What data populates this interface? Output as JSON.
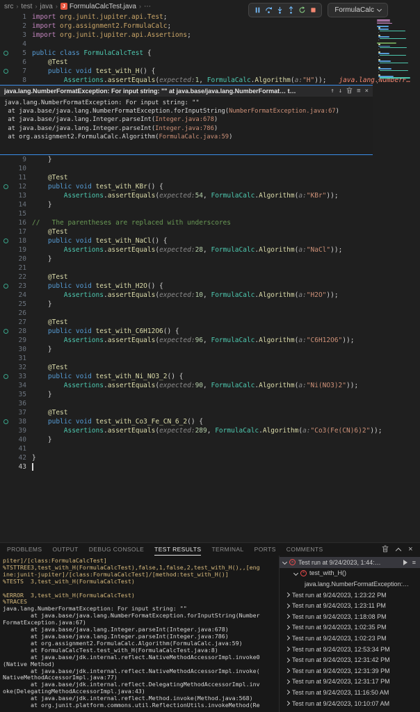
{
  "colors": {
    "accent_blue": "#3b8eea",
    "error_red": "#f14c4c",
    "inline_error_red": "#f48771",
    "test_gutter_teal": "#3aa58b",
    "debug_pause_blue": "#75beff",
    "debug_restart_green": "#89d185",
    "debug_stop_red": "#f48771",
    "stack_link_orange": "#ce9178",
    "console_yellow": "#d7ba7d"
  },
  "icons": {
    "crumb_sep": "›",
    "crumb_more": "⋯",
    "arrow_up": "↑",
    "arrow_down": "↓",
    "list": "≡",
    "close": "×",
    "menu": "≡",
    "java_badge": "J",
    "fail_x": "×"
  },
  "breadcrumb": {
    "path": [
      "src",
      "test",
      "java"
    ],
    "file": "FormulaCalcTest.java"
  },
  "debug_toolbar": {
    "config_label": "FormulaCalc"
  },
  "editor": {
    "lines_top": [
      {
        "n": 1,
        "t": [
          [
            "imp",
            "import"
          ],
          [
            "pkg",
            " org.junit.jupiter.api.Test"
          ],
          [
            "pln",
            ";"
          ]
        ]
      },
      {
        "n": 2,
        "t": [
          [
            "imp",
            "import"
          ],
          [
            "pkg",
            " org.assignment2.FormulaCalc"
          ],
          [
            "pln",
            ";"
          ]
        ]
      },
      {
        "n": 3,
        "t": [
          [
            "imp",
            "import"
          ],
          [
            "pkg",
            " org.junit.jupiter.api.Assertions"
          ],
          [
            "pln",
            ";"
          ]
        ]
      },
      {
        "n": 4,
        "t": []
      },
      {
        "n": 5,
        "icon": true,
        "t": [
          [
            "kw",
            "public class "
          ],
          [
            "cls",
            "FormulaCalcTest"
          ],
          [
            "pln",
            " {"
          ]
        ]
      },
      {
        "n": 6,
        "t": [
          [
            "pln",
            "    "
          ],
          [
            "ann",
            "@Test"
          ]
        ]
      },
      {
        "n": 7,
        "icon": true,
        "t": [
          [
            "pln",
            "    "
          ],
          [
            "kw",
            "public void "
          ],
          [
            "fn",
            "test_with_H"
          ],
          [
            "pln",
            "() {"
          ]
        ]
      },
      {
        "n": 8,
        "t": [
          [
            "pln",
            "        "
          ],
          [
            "cls",
            "Assertions"
          ],
          [
            "pln",
            "."
          ],
          [
            "fn",
            "assertEquals"
          ],
          [
            "pln",
            "("
          ],
          [
            "hint",
            "expected:"
          ],
          [
            "num",
            "1"
          ],
          [
            "pln",
            ", "
          ],
          [
            "cls",
            "FormulaCalc"
          ],
          [
            "pln",
            "."
          ],
          [
            "fn",
            "Algorithm"
          ],
          [
            "pln",
            "("
          ],
          [
            "hint",
            "a:"
          ],
          [
            "str",
            "\"H\""
          ],
          [
            "pln",
            "));"
          ]
        ],
        "trail": "java.lang.NumberF…"
      }
    ],
    "exception_widget": {
      "title": "java.lang.NumberFormatException: For input string: \"\" at java.base/java.lang.NumberFormat…  t…",
      "lines": [
        {
          "pre": "java.lang.NumberFormatException: For input string: \"\""
        },
        {
          "pre": " at java.base/java.lang.NumberFormatException.forInputString(",
          "link": "NumberFormatException.java:67",
          "post": ")"
        },
        {
          "pre": " at java.base/java.lang.Integer.parseInt(",
          "link": "Integer.java:678",
          "post": ")"
        },
        {
          "pre": " at java.base/java.lang.Integer.parseInt(",
          "link": "Integer.java:786",
          "post": ")"
        },
        {
          "pre": " at org.assignment2.FormulaCalc.Algorithm(",
          "link": "FormulaCalc.java:59",
          "post": ")"
        }
      ]
    },
    "lines_bottom": [
      {
        "n": 9,
        "t": [
          [
            "pln",
            "    }"
          ]
        ]
      },
      {
        "n": 10,
        "t": []
      },
      {
        "n": 11,
        "t": [
          [
            "pln",
            "    "
          ],
          [
            "ann",
            "@Test"
          ]
        ]
      },
      {
        "n": 12,
        "icon": true,
        "t": [
          [
            "pln",
            "    "
          ],
          [
            "kw",
            "public void "
          ],
          [
            "fn",
            "test_with_KBr"
          ],
          [
            "pln",
            "() {"
          ]
        ]
      },
      {
        "n": 13,
        "t": [
          [
            "pln",
            "        "
          ],
          [
            "cls",
            "Assertions"
          ],
          [
            "pln",
            "."
          ],
          [
            "fn",
            "assertEquals"
          ],
          [
            "pln",
            "("
          ],
          [
            "hint",
            "expected:"
          ],
          [
            "num",
            "54"
          ],
          [
            "pln",
            ", "
          ],
          [
            "cls",
            "FormulaCalc"
          ],
          [
            "pln",
            "."
          ],
          [
            "fn",
            "Algorithm"
          ],
          [
            "pln",
            "("
          ],
          [
            "hint",
            "a:"
          ],
          [
            "str",
            "\"KBr\""
          ],
          [
            "pln",
            "));"
          ]
        ]
      },
      {
        "n": 14,
        "t": [
          [
            "pln",
            "    }"
          ]
        ]
      },
      {
        "n": 15,
        "t": []
      },
      {
        "n": 16,
        "t": [
          [
            "cmt",
            "//   The parentheses are replaced with underscores"
          ]
        ]
      },
      {
        "n": 17,
        "t": [
          [
            "pln",
            "    "
          ],
          [
            "ann",
            "@Test"
          ]
        ]
      },
      {
        "n": 18,
        "icon": true,
        "t": [
          [
            "pln",
            "    "
          ],
          [
            "kw",
            "public void "
          ],
          [
            "fn",
            "test_with_NaCl"
          ],
          [
            "pln",
            "() {"
          ]
        ]
      },
      {
        "n": 19,
        "t": [
          [
            "pln",
            "        "
          ],
          [
            "cls",
            "Assertions"
          ],
          [
            "pln",
            "."
          ],
          [
            "fn",
            "assertEquals"
          ],
          [
            "pln",
            "("
          ],
          [
            "hint",
            "expected:"
          ],
          [
            "num",
            "28"
          ],
          [
            "pln",
            ", "
          ],
          [
            "cls",
            "FormulaCalc"
          ],
          [
            "pln",
            "."
          ],
          [
            "fn",
            "Algorithm"
          ],
          [
            "pln",
            "("
          ],
          [
            "hint",
            "a:"
          ],
          [
            "str",
            "\"NaCl\""
          ],
          [
            "pln",
            "));"
          ]
        ]
      },
      {
        "n": 20,
        "t": [
          [
            "pln",
            "    }"
          ]
        ]
      },
      {
        "n": 21,
        "t": []
      },
      {
        "n": 22,
        "t": [
          [
            "pln",
            "    "
          ],
          [
            "ann",
            "@Test"
          ]
        ]
      },
      {
        "n": 23,
        "icon": true,
        "t": [
          [
            "pln",
            "    "
          ],
          [
            "kw",
            "public void "
          ],
          [
            "fn",
            "test_with_H2O"
          ],
          [
            "pln",
            "() {"
          ]
        ]
      },
      {
        "n": 24,
        "t": [
          [
            "pln",
            "        "
          ],
          [
            "cls",
            "Assertions"
          ],
          [
            "pln",
            "."
          ],
          [
            "fn",
            "assertEquals"
          ],
          [
            "pln",
            "("
          ],
          [
            "hint",
            "expected:"
          ],
          [
            "num",
            "10"
          ],
          [
            "pln",
            ", "
          ],
          [
            "cls",
            "FormulaCalc"
          ],
          [
            "pln",
            "."
          ],
          [
            "fn",
            "Algorithm"
          ],
          [
            "pln",
            "("
          ],
          [
            "hint",
            "a:"
          ],
          [
            "str",
            "\"H2O\""
          ],
          [
            "pln",
            "));"
          ]
        ]
      },
      {
        "n": 25,
        "t": [
          [
            "pln",
            "    }"
          ]
        ]
      },
      {
        "n": 26,
        "t": []
      },
      {
        "n": 27,
        "t": [
          [
            "pln",
            "    "
          ],
          [
            "ann",
            "@Test"
          ]
        ]
      },
      {
        "n": 28,
        "icon": true,
        "t": [
          [
            "pln",
            "    "
          ],
          [
            "kw",
            "public void "
          ],
          [
            "fn",
            "test_with_C6H12O6"
          ],
          [
            "pln",
            "() {"
          ]
        ]
      },
      {
        "n": 29,
        "t": [
          [
            "pln",
            "        "
          ],
          [
            "cls",
            "Assertions"
          ],
          [
            "pln",
            "."
          ],
          [
            "fn",
            "assertEquals"
          ],
          [
            "pln",
            "("
          ],
          [
            "hint",
            "expected:"
          ],
          [
            "num",
            "96"
          ],
          [
            "pln",
            ", "
          ],
          [
            "cls",
            "FormulaCalc"
          ],
          [
            "pln",
            "."
          ],
          [
            "fn",
            "Algorithm"
          ],
          [
            "pln",
            "("
          ],
          [
            "hint",
            "a:"
          ],
          [
            "str",
            "\"C6H12O6\""
          ],
          [
            "pln",
            "));"
          ]
        ]
      },
      {
        "n": 30,
        "t": [
          [
            "pln",
            "    }"
          ]
        ]
      },
      {
        "n": 31,
        "t": []
      },
      {
        "n": 32,
        "t": [
          [
            "pln",
            "    "
          ],
          [
            "ann",
            "@Test"
          ]
        ]
      },
      {
        "n": 33,
        "icon": true,
        "t": [
          [
            "pln",
            "    "
          ],
          [
            "kw",
            "public void "
          ],
          [
            "fn",
            "test_with_Ni_NO3_2"
          ],
          [
            "pln",
            "() {"
          ]
        ]
      },
      {
        "n": 34,
        "t": [
          [
            "pln",
            "        "
          ],
          [
            "cls",
            "Assertions"
          ],
          [
            "pln",
            "."
          ],
          [
            "fn",
            "assertEquals"
          ],
          [
            "pln",
            "("
          ],
          [
            "hint",
            "expected:"
          ],
          [
            "num",
            "90"
          ],
          [
            "pln",
            ", "
          ],
          [
            "cls",
            "FormulaCalc"
          ],
          [
            "pln",
            "."
          ],
          [
            "fn",
            "Algorithm"
          ],
          [
            "pln",
            "("
          ],
          [
            "hint",
            "a:"
          ],
          [
            "str",
            "\"Ni(NO3)2\""
          ],
          [
            "pln",
            "));"
          ]
        ]
      },
      {
        "n": 35,
        "t": [
          [
            "pln",
            "    }"
          ]
        ]
      },
      {
        "n": 36,
        "t": []
      },
      {
        "n": 37,
        "t": [
          [
            "pln",
            "    "
          ],
          [
            "ann",
            "@Test"
          ]
        ]
      },
      {
        "n": 38,
        "icon": true,
        "t": [
          [
            "pln",
            "    "
          ],
          [
            "kw",
            "public void "
          ],
          [
            "fn",
            "test_with_Co3_Fe_CN_6_2"
          ],
          [
            "pln",
            "() {"
          ]
        ]
      },
      {
        "n": 39,
        "t": [
          [
            "pln",
            "        "
          ],
          [
            "cls",
            "Assertions"
          ],
          [
            "pln",
            "."
          ],
          [
            "fn",
            "assertEquals"
          ],
          [
            "pln",
            "("
          ],
          [
            "hint",
            "expected:"
          ],
          [
            "num",
            "289"
          ],
          [
            "pln",
            ", "
          ],
          [
            "cls",
            "FormulaCalc"
          ],
          [
            "pln",
            "."
          ],
          [
            "fn",
            "Algorithm"
          ],
          [
            "pln",
            "("
          ],
          [
            "hint",
            "a:"
          ],
          [
            "str",
            "\"Co3(Fe(CN)6)2\""
          ],
          [
            "pln",
            "));"
          ]
        ]
      },
      {
        "n": 40,
        "t": [
          [
            "pln",
            "    }"
          ]
        ]
      },
      {
        "n": 41,
        "t": []
      },
      {
        "n": 42,
        "t": [
          [
            "pln",
            "}"
          ]
        ]
      },
      {
        "n": 43,
        "cursor": true,
        "t": []
      }
    ]
  },
  "panel": {
    "tabs": [
      {
        "label": "PROBLEMS"
      },
      {
        "label": "OUTPUT"
      },
      {
        "label": "DEBUG CONSOLE"
      },
      {
        "label": "TEST RESULTS",
        "active": true
      },
      {
        "label": "TERMINAL"
      },
      {
        "label": "PORTS"
      },
      {
        "label": "COMMENTS"
      }
    ],
    "console_lines": [
      {
        "c": "y",
        "t": "piter]/[class:FormulaCalcTest]"
      },
      {
        "c": "y",
        "t": "%TSTTREE3,test_with_H(FormulaCalcTest),false,1,false,2,test_with_H(),,[eng"
      },
      {
        "c": "y",
        "t": "ine:junit-jupiter]/[class:FormulaCalcTest]/[method:test_with_H()]"
      },
      {
        "c": "y",
        "t": "%TESTS  3,test_with_H(FormulaCalcTest)"
      },
      {
        "c": "w",
        "t": ""
      },
      {
        "c": "y",
        "t": "%ERROR  3,test_with_H(FormulaCalcTest)"
      },
      {
        "c": "y",
        "t": "%TRACES"
      },
      {
        "c": "w",
        "t": "java.lang.NumberFormatException: For input string: \"\""
      },
      {
        "c": "w",
        "t": "        at java.base/java.lang.NumberFormatException.forInputString(Number"
      },
      {
        "c": "w",
        "t": "FormatException.java:67)"
      },
      {
        "c": "w",
        "t": "        at java.base/java.lang.Integer.parseInt(Integer.java:678)"
      },
      {
        "c": "w",
        "t": "        at java.base/java.lang.Integer.parseInt(Integer.java:786)"
      },
      {
        "c": "w",
        "t": "        at org.assignment2.FormulaCalc.Algorithm(FormulaCalc.java:59)"
      },
      {
        "c": "w",
        "t": "        at FormulaCalcTest.test_with_H(FormulaCalcTest.java:8)"
      },
      {
        "c": "w",
        "t": "        at java.base/jdk.internal.reflect.NativeMethodAccessorImpl.invoke0"
      },
      {
        "c": "w",
        "t": "(Native Method)"
      },
      {
        "c": "w",
        "t": "        at java.base/jdk.internal.reflect.NativeMethodAccessorImpl.invoke("
      },
      {
        "c": "w",
        "t": "NativeMethodAccessorImpl.java:77)"
      },
      {
        "c": "w",
        "t": "        at java.base/jdk.internal.reflect.DelegatingMethodAccessorImpl.inv"
      },
      {
        "c": "w",
        "t": "oke(DelegatingMethodAccessorImpl.java:43)"
      },
      {
        "c": "w",
        "t": "        at java.base/jdk.internal.reflect.Method.invoke(Method.java:568)"
      },
      {
        "c": "w",
        "t": "        at org.junit.platform.commons.util.ReflectionUtils.invokeMethod(Re"
      }
    ],
    "test_results": {
      "rows": [
        {
          "kind": "run-open",
          "selected": true,
          "label": "Test run at 9/24/2023, 1:44:…"
        },
        {
          "kind": "test",
          "label": "test_with_H()"
        },
        {
          "kind": "msg",
          "label": "java.lang.NumberFormatException:…"
        },
        {
          "kind": "run",
          "label": "Test run at 9/24/2023, 1:23:22 PM"
        },
        {
          "kind": "run",
          "label": "Test run at 9/24/2023, 1:23:11 PM"
        },
        {
          "kind": "run",
          "label": "Test run at 9/24/2023, 1:18:08 PM"
        },
        {
          "kind": "run",
          "label": "Test run at 9/24/2023, 1:02:35 PM"
        },
        {
          "kind": "run",
          "label": "Test run at 9/24/2023, 1:02:23 PM"
        },
        {
          "kind": "run",
          "label": "Test run at 9/24/2023, 12:53:34 PM"
        },
        {
          "kind": "run",
          "label": "Test run at 9/24/2023, 12:31:42 PM"
        },
        {
          "kind": "run",
          "label": "Test run at 9/24/2023, 12:31:39 PM"
        },
        {
          "kind": "run",
          "label": "Test run at 9/24/2023, 12:31:17 PM"
        },
        {
          "kind": "run",
          "label": "Test run at 9/24/2023, 11:16:50 AM"
        },
        {
          "kind": "run",
          "label": "Test run at 9/24/2023, 10:10:07 AM"
        }
      ]
    }
  }
}
